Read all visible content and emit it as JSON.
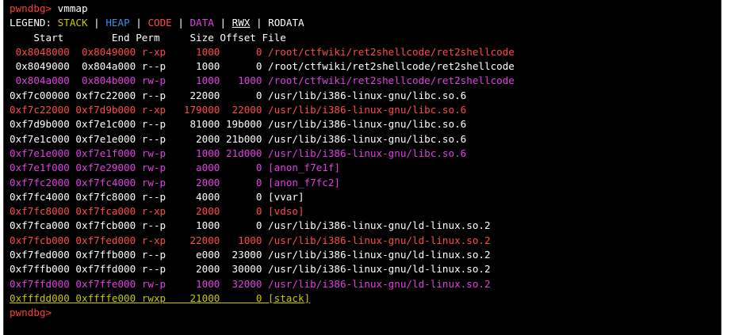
{
  "prompt": "pwndbg>",
  "command": " vmmap",
  "legend": {
    "label": "LEGEND: ",
    "stack": "STACK",
    "heap": "HEAP",
    "code": "CODE",
    "data": "DATA",
    "rwx": "RWX",
    "rodata": "RODATA",
    "separator": " | "
  },
  "header": "    Start        End Perm     Size Offset File",
  "rows": [
    {
      "type": "code",
      "text": " 0x8048000  0x8049000 r-xp     1000      0 /root/ctfwiki/ret2shellcode/ret2shellcode"
    },
    {
      "type": "plain",
      "text": " 0x8049000  0x804a000 r--p     1000      0 /root/ctfwiki/ret2shellcode/ret2shellcode"
    },
    {
      "type": "data",
      "text": " 0x804a000  0x804b000 rw-p     1000   1000 /root/ctfwiki/ret2shellcode/ret2shellcode"
    },
    {
      "type": "plain",
      "text": "0xf7c00000 0xf7c22000 r--p    22000      0 /usr/lib/i386-linux-gnu/libc.so.6"
    },
    {
      "type": "code",
      "text": "0xf7c22000 0xf7d9b000 r-xp   179000  22000 /usr/lib/i386-linux-gnu/libc.so.6"
    },
    {
      "type": "plain",
      "text": "0xf7d9b000 0xf7e1c000 r--p    81000 19b000 /usr/lib/i386-linux-gnu/libc.so.6"
    },
    {
      "type": "plain",
      "text": "0xf7e1c000 0xf7e1e000 r--p     2000 21b000 /usr/lib/i386-linux-gnu/libc.so.6"
    },
    {
      "type": "data",
      "text": "0xf7e1e000 0xf7e1f000 rw-p     1000 21d000 /usr/lib/i386-linux-gnu/libc.so.6"
    },
    {
      "type": "data",
      "text": "0xf7e1f000 0xf7e29000 rw-p     a000      0 [anon_f7e1f]"
    },
    {
      "type": "data",
      "text": "0xf7fc2000 0xf7fc4000 rw-p     2000      0 [anon_f7fc2]"
    },
    {
      "type": "plain",
      "text": "0xf7fc4000 0xf7fc8000 r--p     4000      0 [vvar]"
    },
    {
      "type": "code",
      "text": "0xf7fc8000 0xf7fca000 r-xp     2000      0 [vdso]"
    },
    {
      "type": "plain",
      "text": "0xf7fca000 0xf7fcb000 r--p     1000      0 /usr/lib/i386-linux-gnu/ld-linux.so.2"
    },
    {
      "type": "code",
      "text": "0xf7fcb000 0xf7fed000 r-xp    22000   1000 /usr/lib/i386-linux-gnu/ld-linux.so.2"
    },
    {
      "type": "plain",
      "text": "0xf7fed000 0xf7ffb000 r--p     e000  23000 /usr/lib/i386-linux-gnu/ld-linux.so.2"
    },
    {
      "type": "plain",
      "text": "0xf7ffb000 0xf7ffd000 r--p     2000  30000 /usr/lib/i386-linux-gnu/ld-linux.so.2"
    },
    {
      "type": "data",
      "text": "0xf7ffd000 0xf7ffe000 rw-p     1000  32000 /usr/lib/i386-linux-gnu/ld-linux.so.2"
    },
    {
      "type": "stack",
      "text": "0xfffdd000 0xffffe000 rwxp    21000      0 [stack]"
    }
  ],
  "colors": {
    "background": "#000000",
    "text": "#ffffff",
    "stack": "#c8c800",
    "heap": "#3b8eea",
    "code": "#ff4a4a",
    "data": "#e040e0",
    "prompt": "#ff3d3d"
  }
}
